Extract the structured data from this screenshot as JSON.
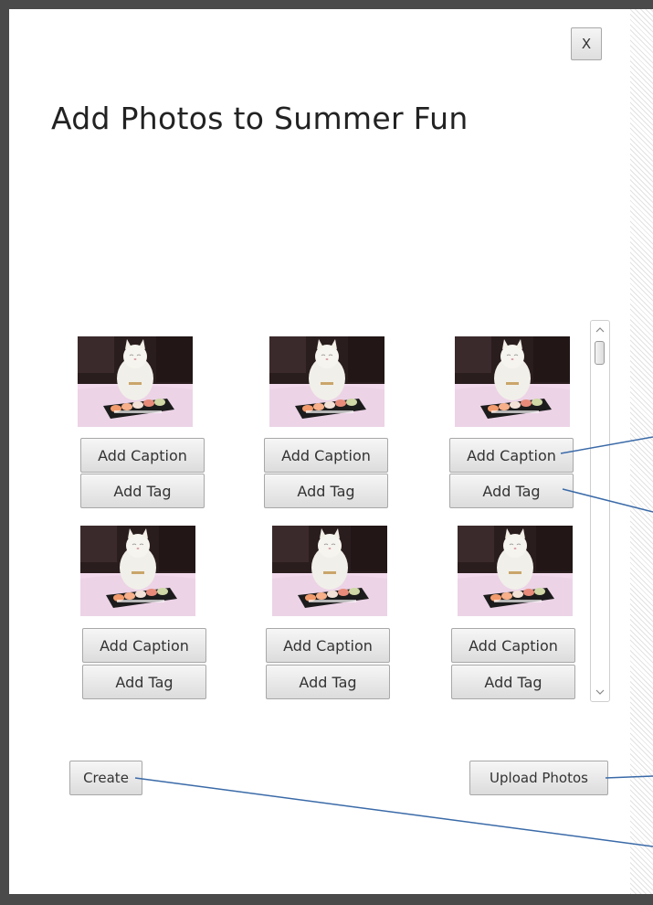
{
  "dialog": {
    "close_label": "X",
    "title": "Add Photos to Summer Fun"
  },
  "photos": [
    {
      "caption_label": "Add Caption",
      "tag_label": "Add Tag"
    },
    {
      "caption_label": "Add Caption",
      "tag_label": "Add Tag"
    },
    {
      "caption_label": "Add Caption",
      "tag_label": "Add Tag"
    },
    {
      "caption_label": "Add Caption",
      "tag_label": "Add Tag"
    },
    {
      "caption_label": "Add Caption",
      "tag_label": "Add Tag"
    },
    {
      "caption_label": "Add Caption",
      "tag_label": "Add Tag"
    }
  ],
  "scrollbar": {
    "up_icon": "chevron-up-icon",
    "down_icon": "chevron-down-icon"
  },
  "footer": {
    "create_label": "Create",
    "upload_label": "Upload Photos"
  },
  "colors": {
    "annotation_line": "#3a6aa8",
    "frame": "#4a4a4a"
  }
}
